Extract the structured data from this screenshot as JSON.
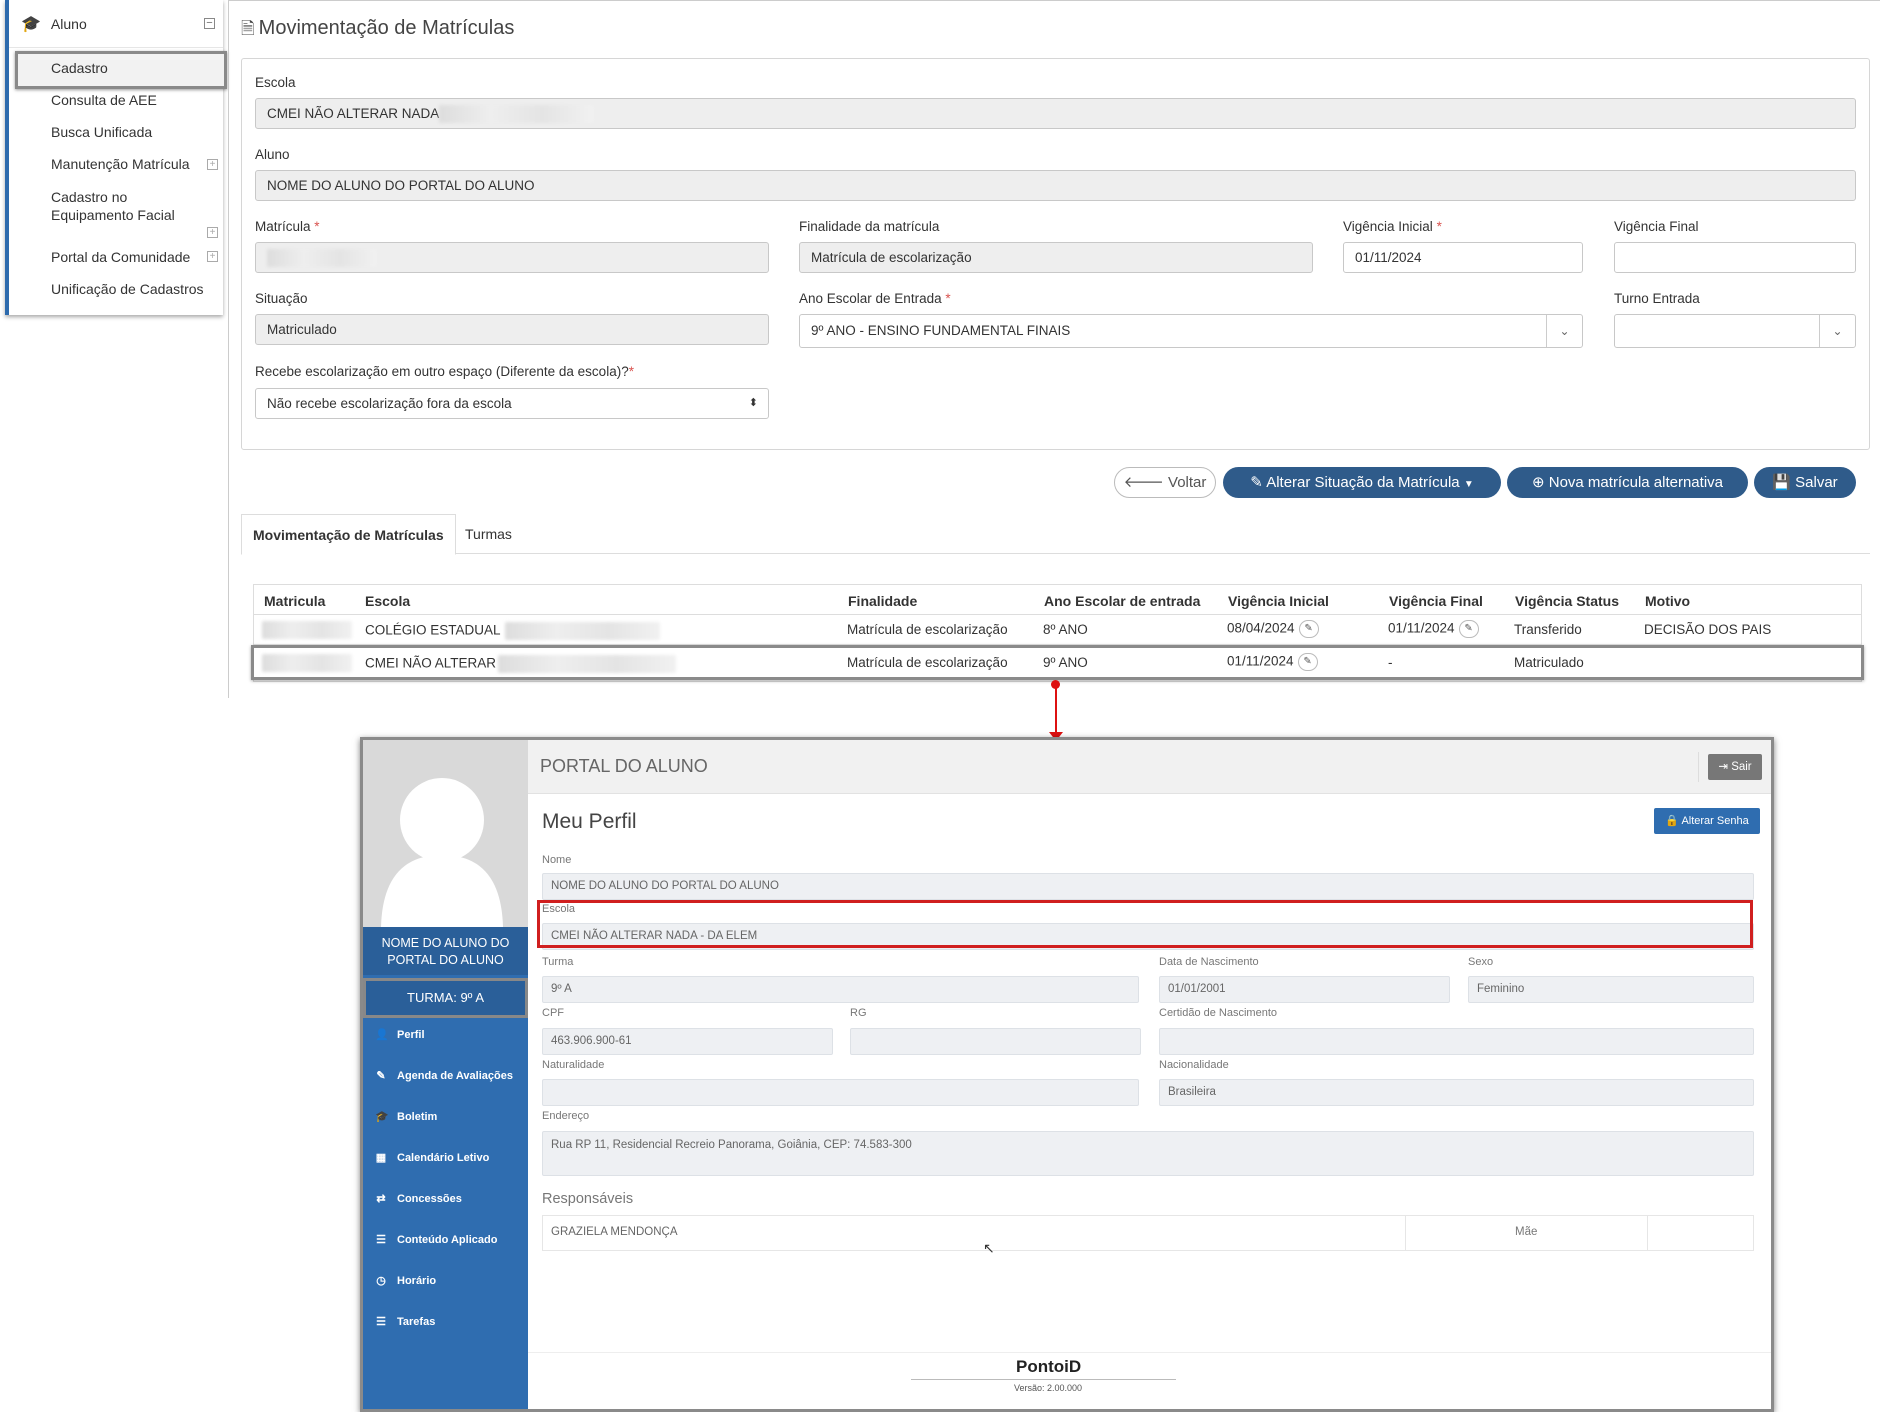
{
  "sidebar": {
    "section": "Aluno",
    "items": [
      {
        "label": "Cadastro"
      },
      {
        "label": "Consulta de AEE"
      },
      {
        "label": "Busca Unificada"
      },
      {
        "label": "Manutenção Matrícula"
      },
      {
        "label": "Cadastro no Equipamento Facial"
      },
      {
        "label": "Portal da Comunidade"
      },
      {
        "label": "Unificação de Cadastros"
      }
    ]
  },
  "form": {
    "page_title": "Movimentação de Matrículas",
    "escola_label": "Escola",
    "escola_value": "CMEI NÃO ALTERAR NADA",
    "aluno_label": "Aluno",
    "aluno_value": "NOME DO ALUNO DO PORTAL DO ALUNO",
    "matricula_label": "Matrícula",
    "finalidade_label": "Finalidade da matrícula",
    "finalidade_value": "Matrícula de escolarização",
    "vig_ini_label": "Vigência Inicial",
    "vig_ini_value": "01/11/2024",
    "vig_fim_label": "Vigência Final",
    "situacao_label": "Situação",
    "situacao_value": "Matriculado",
    "ano_label": "Ano Escolar de Entrada",
    "ano_value": "9º ANO - ENSINO FUNDAMENTAL FINAIS",
    "turno_label": "Turno Entrada",
    "recebe_label": "Recebe escolarização em outro espaço (Diferente da escola)?",
    "recebe_value": "Não recebe escolarização fora da escola",
    "required_mark": "*"
  },
  "buttons": {
    "voltar": "Voltar",
    "alterar": "Alterar Situação da Matrícula",
    "nova": "Nova matrícula alternativa",
    "salvar": "Salvar"
  },
  "tabs": [
    {
      "label": "Movimentação de Matrículas"
    },
    {
      "label": "Turmas"
    }
  ],
  "table": {
    "headers": [
      "Matricula",
      "Escola",
      "Finalidade",
      "Ano Escolar de entrada",
      "Vigência Inicial",
      "Vigência Final",
      "Vigência Status",
      "Motivo"
    ],
    "rows": [
      {
        "escola": "COLÉGIO ESTADUAL",
        "finalidade": "Matrícula de escolarização",
        "ano": "8º ANO",
        "vig_ini": "08/04/2024",
        "vig_fim": "01/11/2024",
        "status": "Transferido",
        "motivo": "DECISÃO DOS PAIS"
      },
      {
        "escola": "CMEI NÃO ALTERAR",
        "finalidade": "Matrícula de escolarização",
        "ano": "9º ANO",
        "vig_ini": "01/11/2024",
        "vig_fim": "-",
        "status": "Matriculado",
        "motivo": ""
      }
    ]
  },
  "portal": {
    "title": "PORTAL DO ALUNO",
    "sair": "Sair",
    "student_name": "NOME DO ALUNO DO PORTAL DO ALUNO",
    "turma_badge": "TURMA: 9º A",
    "menu": [
      "Perfil",
      "Agenda de Avaliações",
      "Boletim",
      "Calendário Letivo",
      "Concessões",
      "Conteúdo Aplicado",
      "Horário",
      "Tarefas"
    ],
    "heading": "Meu Perfil",
    "alterar_senha": "Alterar Senha",
    "fields": {
      "nome_label": "Nome",
      "nome": "NOME DO ALUNO DO PORTAL DO ALUNO",
      "escola_label": "Escola",
      "escola": "CMEI NÃO ALTERAR NADA - DA ELEM",
      "turma_label": "Turma",
      "turma": "9º A",
      "nasc_label": "Data de Nascimento",
      "nasc": "01/01/2001",
      "sexo_label": "Sexo",
      "sexo": "Feminino",
      "cpf_label": "CPF",
      "cpf": "463.906.900-61",
      "rg_label": "RG",
      "rg": "",
      "certidao_label": "Certidão de Nascimento",
      "certidao": "",
      "naturalidade_label": "Naturalidade",
      "naturalidade": "",
      "nacionalidade_label": "Nacionalidade",
      "nacionalidade": "Brasileira",
      "endereco_label": "Endereço",
      "endereco": "Rua RP 11, Residencial Recreio Panorama, Goiânia, CEP: 74.583-300"
    },
    "responsaveis_label": "Responsáveis",
    "responsavel": {
      "nome": "GRAZIELA MENDONÇA",
      "parentesco": "Mãe"
    },
    "brand": "PontoiD",
    "version": "Versão: 2.00.000"
  },
  "colors": {
    "primary": "#2f5b8a",
    "portal_blue": "#2f6db0",
    "highlight_red": "#d01f1f",
    "required": "#d9534f"
  }
}
